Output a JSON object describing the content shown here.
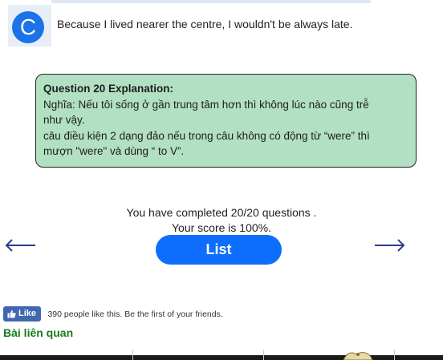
{
  "option": {
    "letter": "C",
    "text": "Because I lived nearer the centre, I wouldn't be always late."
  },
  "explanation": {
    "title": "Question 20 Explanation:",
    "lines": [
      "Nghĩa: Nếu tôi sống ở gần trung tâm hơn thì không lúc nào cũng trễ",
      "như vậy.",
      "câu điều kiện 2 dạng đảo nếu trong câu không có động từ “were” thì",
      "mượn \"were\" và dùng “ to V”."
    ]
  },
  "result": {
    "completed": "You have completed 20/20 questions .",
    "score": "Your score is 100%."
  },
  "list_button": {
    "label": "List"
  },
  "nav": {
    "prev_icon": "arrow-left-icon",
    "next_icon": "arrow-right-icon",
    "color": "#2b3a8c"
  },
  "facebook": {
    "like_label": "Like",
    "like_text": "390 people like this. Be the first of your friends."
  },
  "related": {
    "heading": "Bài liên quan"
  },
  "colors": {
    "option_circle": "#1a73e8",
    "explanation_bg": "#b2e0c3",
    "button": "#0d6efd",
    "facebook": "#4267b2",
    "related_heading": "#1a7a1a"
  }
}
